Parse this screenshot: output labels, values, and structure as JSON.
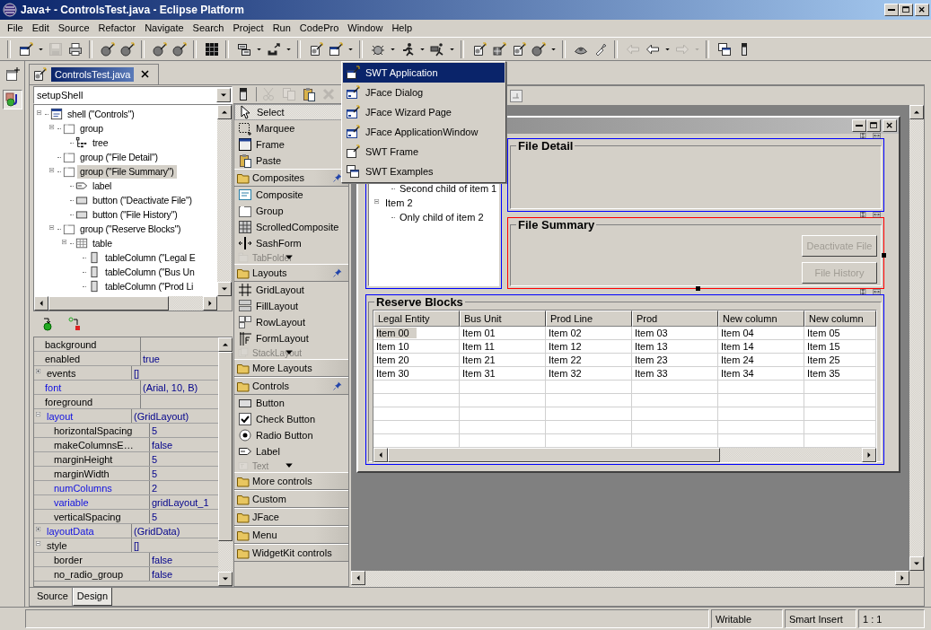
{
  "window": {
    "title": "Java+ - ControlsTest.java - Eclipse Platform"
  },
  "menu_bar": [
    "File",
    "Edit",
    "Source",
    "Refactor",
    "Navigate",
    "Search",
    "Project",
    "Run",
    "CodePro",
    "Window",
    "Help"
  ],
  "toolbar": [
    {
      "kind": "sep"
    },
    {
      "kind": "new",
      "disabled": false
    },
    {
      "kind": "caret",
      "disabled": false
    },
    {
      "kind": "save",
      "disabled": true
    },
    {
      "kind": "print",
      "disabled": false
    },
    {
      "kind": "sep"
    },
    {
      "kind": "wand",
      "disabled": false
    },
    {
      "kind": "wand",
      "disabled": false
    },
    {
      "kind": "sep"
    },
    {
      "kind": "wand",
      "disabled": false
    },
    {
      "kind": "wand",
      "disabled": false
    },
    {
      "kind": "sep"
    },
    {
      "kind": "grid",
      "disabled": false
    },
    {
      "kind": "sep"
    },
    {
      "kind": "build",
      "disabled": false
    },
    {
      "kind": "caret",
      "disabled": false
    },
    {
      "kind": "export",
      "disabled": false
    },
    {
      "kind": "caret",
      "disabled": false
    },
    {
      "kind": "sep"
    },
    {
      "kind": "page",
      "disabled": false
    },
    {
      "kind": "new",
      "disabled": false
    },
    {
      "kind": "caret",
      "disabled": false
    },
    {
      "kind": "sep"
    },
    {
      "kind": "debug",
      "disabled": false
    },
    {
      "kind": "caret",
      "disabled": false
    },
    {
      "kind": "run",
      "disabled": false
    },
    {
      "kind": "caret",
      "disabled": false
    },
    {
      "kind": "tools",
      "disabled": false
    },
    {
      "kind": "caret",
      "disabled": false
    },
    {
      "kind": "sep"
    },
    {
      "kind": "page",
      "disabled": false
    },
    {
      "kind": "gridwand",
      "disabled": false
    },
    {
      "kind": "page",
      "disabled": false
    },
    {
      "kind": "wand",
      "disabled": false
    },
    {
      "kind": "caret",
      "disabled": false
    },
    {
      "kind": "sep"
    },
    {
      "kind": "disc",
      "disabled": false
    },
    {
      "kind": "light",
      "disabled": false
    },
    {
      "kind": "sep"
    },
    {
      "kind": "back",
      "disabled": true
    },
    {
      "kind": "back",
      "disabled": false
    },
    {
      "kind": "caret",
      "disabled": false
    },
    {
      "kind": "fwd",
      "disabled": true
    },
    {
      "kind": "caret",
      "disabled": true
    },
    {
      "kind": "sep"
    },
    {
      "kind": "win",
      "disabled": false
    },
    {
      "kind": "marker",
      "disabled": false
    }
  ],
  "perspective_bar": [
    {
      "kind": "open",
      "selected": false
    },
    {
      "kind": "java",
      "selected": true
    }
  ],
  "editor_tab": {
    "label": "ControlsTest.java",
    "selected": true
  },
  "method_combo": {
    "value": "setupShell"
  },
  "outline": [
    {
      "label": "shell (\"Controls\")",
      "kind": "shell",
      "selected": false,
      "expanded": true,
      "children": [
        {
          "label": "group",
          "kind": "group",
          "selected": false,
          "expanded": true,
          "children": [
            {
              "label": "tree",
              "kind": "tree",
              "selected": false
            }
          ]
        },
        {
          "label": "group (\"File Detail\")",
          "kind": "group",
          "selected": false
        },
        {
          "label": "group (\"File Summary\")",
          "kind": "group",
          "selected": true,
          "expanded": true,
          "children": [
            {
              "label": "label",
              "kind": "label",
              "selected": false
            },
            {
              "label": "button (\"Deactivate File\")",
              "kind": "button",
              "selected": false
            },
            {
              "label": "button (\"File History\")",
              "kind": "button",
              "selected": false
            }
          ]
        },
        {
          "label": "group (\"Reserve Blocks\")",
          "kind": "group",
          "selected": false,
          "expanded": true,
          "children": [
            {
              "label": "table",
              "kind": "table",
              "selected": false,
              "expanded": true,
              "children": [
                {
                  "label": "tableColumn (\"Legal E",
                  "kind": "column",
                  "selected": false
                },
                {
                  "label": "tableColumn (\"Bus Un",
                  "kind": "column",
                  "selected": false
                },
                {
                  "label": "tableColumn (\"Prod Li",
                  "kind": "column",
                  "selected": false
                }
              ]
            }
          ]
        }
      ]
    }
  ],
  "properties": [
    {
      "name": "background",
      "modified": false
    },
    {
      "name": "enabled",
      "value": "true",
      "modified": false
    },
    {
      "name": "events",
      "value": "[]",
      "modified": false,
      "expanded": false
    },
    {
      "name": "font",
      "value": "(Arial, 10, B)",
      "modified": true
    },
    {
      "name": "foreground",
      "modified": false
    },
    {
      "name": "layout",
      "value": "(GridLayout)",
      "modified": true,
      "expanded": true,
      "children": [
        {
          "name": "horizontalSpacing",
          "value": "5",
          "modified": false
        },
        {
          "name": "makeColumnsE…",
          "value": "false",
          "modified": false
        },
        {
          "name": "marginHeight",
          "value": "5",
          "modified": false
        },
        {
          "name": "marginWidth",
          "value": "5",
          "modified": false
        },
        {
          "name": "numColumns",
          "value": "2",
          "modified": true
        },
        {
          "name": "variable",
          "value": "gridLayout_1",
          "modified": true
        },
        {
          "name": "verticalSpacing",
          "value": "5",
          "modified": false
        }
      ]
    },
    {
      "name": "layoutData",
      "value": "(GridData)",
      "modified": true,
      "expanded": false
    },
    {
      "name": "style",
      "value": "[]",
      "modified": false,
      "expanded": true,
      "children": [
        {
          "name": "border",
          "value": "false",
          "modified": false
        },
        {
          "name": "no_radio_group",
          "value": "false",
          "modified": false
        }
      ]
    }
  ],
  "palette_toolbar": [
    {
      "kind": "select",
      "disabled": false
    },
    {
      "kind": "cut",
      "disabled": true
    },
    {
      "kind": "copy",
      "disabled": true
    },
    {
      "kind": "paste",
      "disabled": false
    },
    {
      "kind": "delete",
      "disabled": true
    }
  ],
  "palette": [
    {
      "kind": "select",
      "label": "Select",
      "selected": true,
      "disabled": false
    },
    {
      "kind": "marquee",
      "label": "Marquee",
      "selected": false,
      "disabled": false
    },
    {
      "kind": "frame",
      "label": "Frame",
      "selected": false,
      "disabled": false
    },
    {
      "kind": "paste",
      "label": "Paste",
      "selected": false,
      "disabled": false
    },
    {
      "kind": "category",
      "label": "Composites",
      "pinned": true
    },
    {
      "kind": "composite",
      "label": "Composite",
      "selected": false,
      "disabled": false
    },
    {
      "kind": "group",
      "label": "Group",
      "selected": false,
      "disabled": false
    },
    {
      "kind": "scrolled_composite",
      "label": "ScrolledComposite",
      "selected": false,
      "disabled": false
    },
    {
      "kind": "sash_form",
      "label": "SashForm",
      "selected": false,
      "disabled": false
    },
    {
      "kind": "tab_folder",
      "label": "TabFolder",
      "selected": false,
      "disabled": true
    },
    {
      "kind": "category",
      "label": "Layouts",
      "pinned": true
    },
    {
      "kind": "grid_layout",
      "label": "GridLayout",
      "selected": false,
      "disabled": false
    },
    {
      "kind": "fill_layout",
      "label": "FillLayout",
      "selected": false,
      "disabled": false
    },
    {
      "kind": "row_layout",
      "label": "RowLayout",
      "selected": false,
      "disabled": false
    },
    {
      "kind": "form_layout",
      "label": "FormLayout",
      "selected": false,
      "disabled": false
    },
    {
      "kind": "stack_layout",
      "label": "StackLayout",
      "selected": false,
      "disabled": true
    },
    {
      "kind": "category",
      "label": "More Layouts",
      "pinned": false
    },
    {
      "kind": "category",
      "label": "Controls",
      "pinned": true
    },
    {
      "kind": "button",
      "label": "Button",
      "selected": false,
      "disabled": false
    },
    {
      "kind": "check_button",
      "label": "Check Button",
      "selected": false,
      "disabled": false
    },
    {
      "kind": "radio_button",
      "label": "Radio Button",
      "selected": false,
      "disabled": false
    },
    {
      "kind": "label",
      "label": "Label",
      "selected": false,
      "disabled": false
    },
    {
      "kind": "text",
      "label": "Text",
      "selected": false,
      "disabled": true
    },
    {
      "kind": "category",
      "label": "More controls",
      "pinned": false
    },
    {
      "kind": "category",
      "label": "Custom",
      "pinned": false
    },
    {
      "kind": "category",
      "label": "JFace",
      "pinned": false
    },
    {
      "kind": "category",
      "label": "Menu",
      "pinned": false
    },
    {
      "kind": "category",
      "label": "WidgetKit controls",
      "pinned": false
    }
  ],
  "bottom_tabs": [
    {
      "label": "Source",
      "selected": false
    },
    {
      "label": "Design",
      "selected": true
    }
  ],
  "design": {
    "tree": {
      "selected": false,
      "items": [
        {
          "label": "Second child of item 1",
          "kind": "child"
        },
        {
          "label": "Item 2",
          "kind": "item",
          "expanded": true,
          "children": [
            {
              "label": "Only child of item 2",
              "kind": "child"
            }
          ]
        }
      ]
    },
    "groups": [
      {
        "title": "File Detail",
        "selected": false
      },
      {
        "title": "File Summary",
        "selected": true,
        "buttons": [
          {
            "label": "Deactivate File",
            "disabled": true
          },
          {
            "label": "File History",
            "disabled": true
          }
        ]
      }
    ],
    "table_group": {
      "title": "Reserve Blocks",
      "selected": false,
      "columns": [
        "Legal Entity",
        "Bus Unit",
        "Prod Line",
        "Prod",
        "New column",
        "New column"
      ],
      "rows": [
        {
          "cells": [
            "Item 00",
            "Item 01",
            "Item 02",
            "Item 03",
            "Item 04",
            "Item 05"
          ],
          "selected": true
        },
        {
          "cells": [
            "Item 10",
            "Item 11",
            "Item 12",
            "Item 13",
            "Item 14",
            "Item 15"
          ],
          "selected": false
        },
        {
          "cells": [
            "Item 20",
            "Item 21",
            "Item 22",
            "Item 23",
            "Item 24",
            "Item 25"
          ],
          "selected": false
        },
        {
          "cells": [
            "Item 30",
            "Item 31",
            "Item 32",
            "Item 33",
            "Item 34",
            "Item 35"
          ],
          "selected": false
        }
      ]
    }
  },
  "new_menu": [
    {
      "label": "SWT Application",
      "kind": "application",
      "selected": true
    },
    {
      "label": "JFace Dialog",
      "kind": "dialog",
      "selected": false
    },
    {
      "label": "JFace Wizard Page",
      "kind": "wizard",
      "selected": false
    },
    {
      "label": "JFace ApplicationWindow",
      "kind": "application_window",
      "selected": false
    },
    {
      "label": "SWT Frame",
      "kind": "frame",
      "selected": false
    },
    {
      "label": "SWT Examples",
      "kind": "examples",
      "selected": false
    }
  ],
  "status_bar": [
    "Writable",
    "Smart Insert",
    "1 : 1"
  ]
}
